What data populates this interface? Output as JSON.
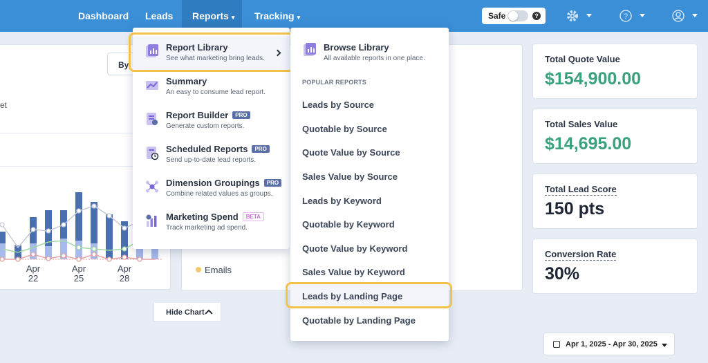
{
  "nav": {
    "items": [
      {
        "label": "Dashboard"
      },
      {
        "label": "Leads"
      },
      {
        "label": "Reports"
      },
      {
        "label": "Tracking"
      }
    ],
    "safe_label": "Safe",
    "help_mark": "?"
  },
  "background": {
    "by_button_label": "By",
    "fragment_text": "et",
    "x_ticks": [
      {
        "line1": "Apr",
        "line2": "22"
      },
      {
        "line1": "Apr",
        "line2": "25"
      },
      {
        "line1": "Apr",
        "line2": "28"
      }
    ],
    "legend_label": "Emails",
    "hide_chart_label": "Hide Chart",
    "date_range": "Apr 1, 2025 - Apr 30, 2025"
  },
  "kpis": [
    {
      "label": "Total Quote Value",
      "value": "$154,900.00"
    },
    {
      "label": "Total Sales Value",
      "value": "$14,695.00"
    },
    {
      "label": "Total Lead Score",
      "value": "150 pts"
    },
    {
      "label": "Conversion Rate",
      "value": "30%"
    }
  ],
  "reports_menu": {
    "items": [
      {
        "title": "Report Library",
        "subtitle": "See what marketing bring leads.",
        "badge": ""
      },
      {
        "title": "Summary",
        "subtitle": "An easy to consume lead report.",
        "badge": ""
      },
      {
        "title": "Report Builder",
        "subtitle": "Generate custom reports.",
        "badge": "PRO"
      },
      {
        "title": "Scheduled Reports",
        "subtitle": "Send up-to-date lead reports.",
        "badge": "PRO"
      },
      {
        "title": "Dimension Groupings",
        "subtitle": "Combine related values as groups.",
        "badge": "PRO"
      },
      {
        "title": "Marketing Spend",
        "subtitle": "Track marketing ad spend.",
        "badge": "BETA"
      }
    ]
  },
  "library_menu": {
    "browse_title": "Browse Library",
    "browse_subtitle": "All available reports in one place.",
    "heading": "POPULAR REPORTS",
    "reports": [
      "Leads by Source",
      "Quotable by Source",
      "Quote Value by Source",
      "Sales Value by Source",
      "Leads by Keyword",
      "Quotable by Keyword",
      "Quote Value by Keyword",
      "Sales Value by Keyword",
      "Leads by Landing Page",
      "Quotable by Landing Page"
    ]
  },
  "colors": {
    "nav": "#3b8fd6",
    "accent_green": "#3aa17e",
    "highlight": "#f3c24a",
    "bar_dark": "#4a6fb0",
    "bar_light": "#a8b9ec"
  }
}
